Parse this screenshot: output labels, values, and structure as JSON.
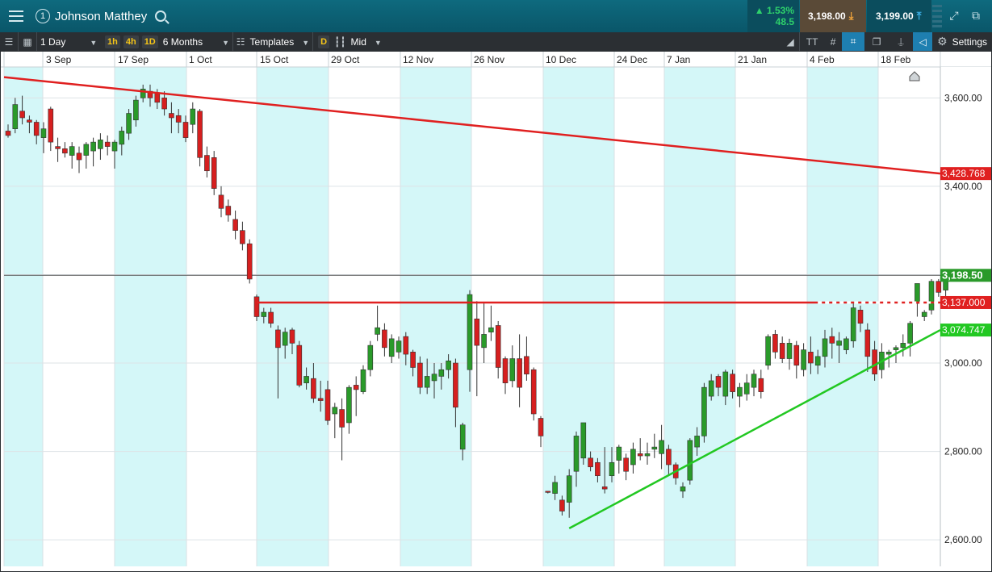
{
  "header": {
    "instrument_name": "Johnson Matthey",
    "notification_count": "1",
    "change_percent": "1.53%",
    "change_points": "48.5",
    "sell_price": "3,198.00",
    "buy_price": "3,199.00",
    "up_arrow": "▲",
    "sell_arrow": "⤓",
    "buy_arrow": "⤒"
  },
  "toolbar": {
    "interval": "1 Day",
    "tf_1h": "1h",
    "tf_4h": "4h",
    "tf_1d": "1D",
    "range": "6 Months",
    "templates": "Templates",
    "d_label": "D",
    "price_type": "Mid",
    "text_tool": "TT",
    "settings": "Settings"
  },
  "colors": {
    "up_candle": "#2a9a2a",
    "down_candle": "#d61f1f",
    "shade": "#d4f7f8",
    "resistance_line": "#e02020",
    "support_line": "#22c822"
  },
  "chart_data": {
    "type": "candlestick",
    "x_labels": [
      "3 Sep",
      "17 Sep",
      "1 Oct",
      "15 Oct",
      "29 Oct",
      "12 Nov",
      "26 Nov",
      "10 Dec",
      "24 Dec",
      "7 Jan",
      "21 Jan",
      "4 Feb",
      "18 Feb"
    ],
    "y_ticks": [
      3600,
      3400,
      3200,
      3000,
      2800,
      2600
    ],
    "y_tick_labels": [
      "3,600.00",
      "3,400.00",
      "3,200.00",
      "3,000.00",
      "2,800.00",
      "2,600.00"
    ],
    "ylim": [
      2540,
      3670
    ],
    "price_tags": [
      {
        "label": "3,428.768",
        "value": 3428.77,
        "color": "#e02020"
      },
      {
        "label": "3,198.50",
        "value": 3198.5,
        "color": "#2a9a2a"
      },
      {
        "label": "3,137.000",
        "value": 3137.0,
        "color": "#e02020"
      },
      {
        "label": "3,074.747",
        "value": 3074.75,
        "color": "#22c822"
      }
    ],
    "current_price": 3198.5,
    "trendlines": [
      {
        "name": "upper",
        "color": "#e02020",
        "from": {
          "bar": -1,
          "price": 3647
        },
        "to": {
          "bar": 137,
          "price": 3428.77
        }
      },
      {
        "name": "horizontal",
        "color": "#e02020",
        "from": {
          "bar": 35,
          "price": 3137
        },
        "to": {
          "bar": 137,
          "price": 3137
        }
      },
      {
        "name": "rising",
        "color": "#22c822",
        "from": {
          "bar": 79,
          "price": 2626
        },
        "to": {
          "bar": 137,
          "price": 3074.75
        }
      }
    ],
    "candles": [
      [
        3525,
        3540,
        3510,
        3515
      ],
      [
        3530,
        3600,
        3520,
        3585
      ],
      [
        3570,
        3605,
        3540,
        3555
      ],
      [
        3550,
        3560,
        3520,
        3545
      ],
      [
        3545,
        3550,
        3495,
        3515
      ],
      [
        3510,
        3545,
        3475,
        3530
      ],
      [
        3575,
        3580,
        3480,
        3500
      ],
      [
        3490,
        3510,
        3455,
        3485
      ],
      [
        3485,
        3500,
        3465,
        3475
      ],
      [
        3470,
        3500,
        3440,
        3490
      ],
      [
        3475,
        3490,
        3430,
        3460
      ],
      [
        3470,
        3500,
        3440,
        3495
      ],
      [
        3480,
        3510,
        3445,
        3500
      ],
      [
        3485,
        3520,
        3460,
        3505
      ],
      [
        3500,
        3515,
        3470,
        3490
      ],
      [
        3480,
        3505,
        3440,
        3500
      ],
      [
        3495,
        3535,
        3470,
        3525
      ],
      [
        3520,
        3575,
        3505,
        3565
      ],
      [
        3550,
        3605,
        3535,
        3595
      ],
      [
        3600,
        3630,
        3590,
        3620
      ],
      [
        3615,
        3630,
        3580,
        3600
      ],
      [
        3610,
        3620,
        3575,
        3590
      ],
      [
        3600,
        3615,
        3560,
        3575
      ],
      [
        3565,
        3590,
        3520,
        3555
      ],
      [
        3560,
        3575,
        3520,
        3545
      ],
      [
        3545,
        3560,
        3500,
        3510
      ],
      [
        3540,
        3590,
        3520,
        3575
      ],
      [
        3570,
        3575,
        3445,
        3465
      ],
      [
        3470,
        3490,
        3420,
        3435
      ],
      [
        3465,
        3480,
        3380,
        3395
      ],
      [
        3380,
        3400,
        3330,
        3350
      ],
      [
        3355,
        3370,
        3320,
        3335
      ],
      [
        3325,
        3345,
        3280,
        3300
      ],
      [
        3300,
        3320,
        3255,
        3270
      ],
      [
        3270,
        3280,
        3180,
        3190
      ],
      [
        3150,
        3155,
        3095,
        3105
      ],
      [
        3105,
        3125,
        3090,
        3115
      ],
      [
        3115,
        3125,
        3080,
        3090
      ],
      [
        3075,
        3085,
        2920,
        3035
      ],
      [
        3040,
        3080,
        3010,
        3070
      ],
      [
        3075,
        3080,
        3020,
        3045
      ],
      [
        3040,
        3050,
        2945,
        2950
      ],
      [
        2955,
        2990,
        2940,
        2970
      ],
      [
        2965,
        3000,
        2910,
        2920
      ],
      [
        2920,
        2960,
        2890,
        2915
      ],
      [
        2940,
        2960,
        2860,
        2870
      ],
      [
        2885,
        2910,
        2830,
        2900
      ],
      [
        2895,
        2920,
        2780,
        2855
      ],
      [
        2865,
        2950,
        2840,
        2945
      ],
      [
        2950,
        2970,
        2880,
        2940
      ],
      [
        2935,
        2995,
        2930,
        2985
      ],
      [
        2985,
        3050,
        2970,
        3040
      ],
      [
        3065,
        3130,
        3050,
        3080
      ],
      [
        3075,
        3090,
        3015,
        3035
      ],
      [
        3015,
        3065,
        3000,
        3055
      ],
      [
        3025,
        3060,
        3010,
        3050
      ],
      [
        3060,
        3070,
        2995,
        3020
      ],
      [
        3025,
        3030,
        2970,
        2990
      ],
      [
        3000,
        3015,
        2930,
        2945
      ],
      [
        2945,
        3010,
        2930,
        2970
      ],
      [
        2960,
        3000,
        2920,
        2975
      ],
      [
        2970,
        3000,
        2940,
        2985
      ],
      [
        2985,
        3020,
        2965,
        3005
      ],
      [
        3000,
        3010,
        2855,
        2900
      ],
      [
        2805,
        2865,
        2780,
        2860
      ],
      [
        2985,
        3165,
        2935,
        3155
      ],
      [
        3100,
        3140,
        2925,
        3040
      ],
      [
        3035,
        3135,
        3000,
        3065
      ],
      [
        3070,
        3130,
        3050,
        3080
      ],
      [
        3085,
        3095,
        2965,
        2990
      ],
      [
        3010,
        3015,
        2930,
        2955
      ],
      [
        2960,
        3040,
        2945,
        3010
      ],
      [
        3010,
        3065,
        2900,
        2945
      ],
      [
        3015,
        3060,
        2960,
        2975
      ],
      [
        2985,
        2990,
        2870,
        2885
      ],
      [
        2875,
        2880,
        2810,
        2835
      ],
      [
        2710,
        2710,
        2705,
        2708
      ],
      [
        2705,
        2745,
        2690,
        2730
      ],
      [
        2690,
        2700,
        2655,
        2665
      ],
      [
        2685,
        2760,
        2650,
        2745
      ],
      [
        2755,
        2845,
        2720,
        2835
      ],
      [
        2785,
        2865,
        2770,
        2865
      ],
      [
        2785,
        2800,
        2755,
        2765
      ],
      [
        2775,
        2785,
        2730,
        2745
      ],
      [
        2720,
        2810,
        2705,
        2715
      ],
      [
        2745,
        2810,
        2730,
        2775
      ],
      [
        2780,
        2815,
        2750,
        2810
      ],
      [
        2785,
        2795,
        2735,
        2755
      ],
      [
        2770,
        2820,
        2750,
        2805
      ],
      [
        2795,
        2830,
        2780,
        2790
      ],
      [
        2790,
        2820,
        2770,
        2795
      ],
      [
        2805,
        2840,
        2785,
        2810
      ],
      [
        2795,
        2860,
        2760,
        2825
      ],
      [
        2805,
        2815,
        2745,
        2770
      ],
      [
        2770,
        2775,
        2725,
        2740
      ],
      [
        2710,
        2730,
        2695,
        2720
      ],
      [
        2735,
        2830,
        2725,
        2825
      ],
      [
        2810,
        2855,
        2790,
        2835
      ],
      [
        2835,
        2955,
        2820,
        2945
      ],
      [
        2925,
        2975,
        2915,
        2960
      ],
      [
        2970,
        2975,
        2925,
        2945
      ],
      [
        2925,
        2985,
        2905,
        2980
      ],
      [
        2975,
        2985,
        2920,
        2935
      ],
      [
        2925,
        2955,
        2900,
        2945
      ],
      [
        2930,
        2975,
        2915,
        2955
      ],
      [
        2945,
        2985,
        2925,
        2975
      ],
      [
        2965,
        2985,
        2920,
        2935
      ],
      [
        2995,
        3065,
        2985,
        3060
      ],
      [
        3065,
        3075,
        3010,
        3025
      ],
      [
        3045,
        3060,
        3000,
        3010
      ],
      [
        3010,
        3055,
        2985,
        3045
      ],
      [
        3040,
        3050,
        2965,
        2995
      ],
      [
        2985,
        3045,
        2970,
        3030
      ],
      [
        3025,
        3060,
        2975,
        3000
      ],
      [
        2995,
        3030,
        2975,
        3015
      ],
      [
        3015,
        3075,
        2990,
        3055
      ],
      [
        3060,
        3080,
        3010,
        3045
      ],
      [
        3040,
        3070,
        3000,
        3050
      ],
      [
        3030,
        3060,
        3020,
        3055
      ],
      [
        3050,
        3135,
        3035,
        3125
      ],
      [
        3120,
        3130,
        3070,
        3090
      ],
      [
        3075,
        3090,
        2980,
        3015
      ],
      [
        3030,
        3050,
        2960,
        2975
      ],
      [
        2985,
        3045,
        2965,
        3025
      ],
      [
        3020,
        3030,
        2990,
        3025
      ],
      [
        3030,
        3040,
        3000,
        3035
      ],
      [
        3035,
        3065,
        3015,
        3045
      ],
      [
        3045,
        3095,
        3015,
        3090
      ],
      [
        3135,
        3175,
        3105,
        3180
      ],
      [
        3105,
        3120,
        3095,
        3115
      ],
      [
        3120,
        3190,
        3110,
        3185
      ],
      [
        3185,
        3190,
        3150,
        3160
      ],
      [
        3165,
        3205,
        3150,
        3195
      ]
    ]
  }
}
